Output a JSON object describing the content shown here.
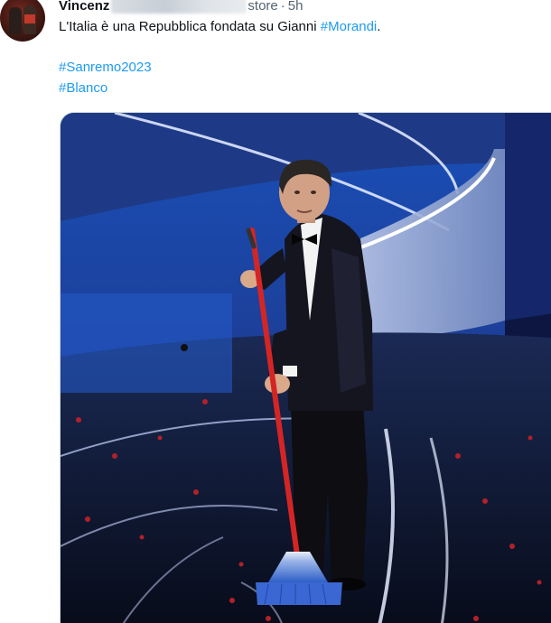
{
  "tweet": {
    "author_name": "Vincenz",
    "handle_tail": "store",
    "separator": "·",
    "timestamp": "5h",
    "text_before": "L'Italia è una Repubblica fondata su Gianni ",
    "mention_hashtag": "#Morandi",
    "text_after": ".",
    "hashtags": [
      "#Sanremo2023",
      "#Blanco"
    ]
  },
  "icons": {
    "avatar": "profile-photo",
    "media": "stage-photo-man-with-broom"
  },
  "colors": {
    "link": "#1d9bf0",
    "text": "#0f1419",
    "secondary": "#536471",
    "media_border": "#cfd9de"
  }
}
